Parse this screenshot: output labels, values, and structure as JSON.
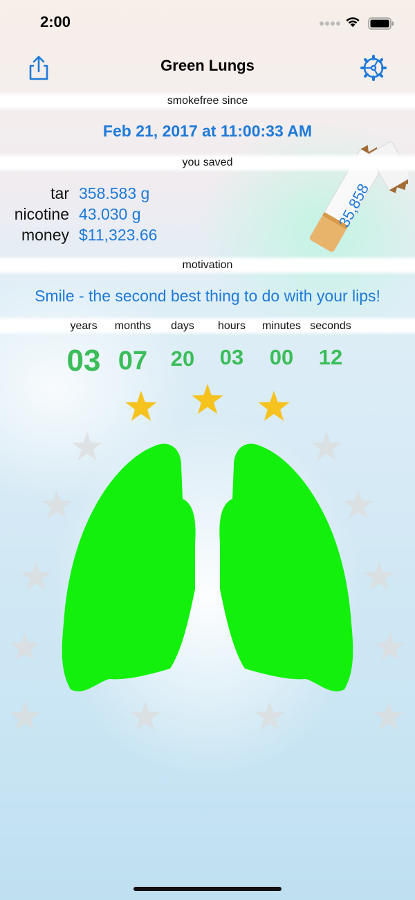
{
  "status_bar": {
    "time": "2:00"
  },
  "nav": {
    "title": "Green Lungs",
    "share_icon": "share-icon",
    "settings_icon": "gear-icon"
  },
  "smokefree": {
    "label": "smokefree since",
    "date": "Feb 21, 2017 at 11:00:33 AM"
  },
  "saved": {
    "label": "you saved",
    "items": [
      {
        "label": "tar",
        "value": "358.583 g"
      },
      {
        "label": "nicotine",
        "value": "43.030 g"
      },
      {
        "label": "money",
        "value": "$11,323.66"
      }
    ],
    "cigarettes_count": "35,858"
  },
  "motivation": {
    "label": "motivation",
    "text": "Smile - the second best thing to do with your lips!"
  },
  "elapsed": {
    "headers": [
      "years",
      "months",
      "days",
      "hours",
      "minutes",
      "seconds"
    ],
    "values": [
      "03",
      "07",
      "20",
      "03",
      "00",
      "12"
    ]
  },
  "achievements": {
    "earned_stars": 3,
    "total_stars": 12
  },
  "colors": {
    "accent": "#1e7ad8",
    "counter_green": "#3bbd5a",
    "lungs_green": "#12f00c",
    "star_gold": "#f6c21d",
    "star_inactive": "#dcdcdc"
  }
}
